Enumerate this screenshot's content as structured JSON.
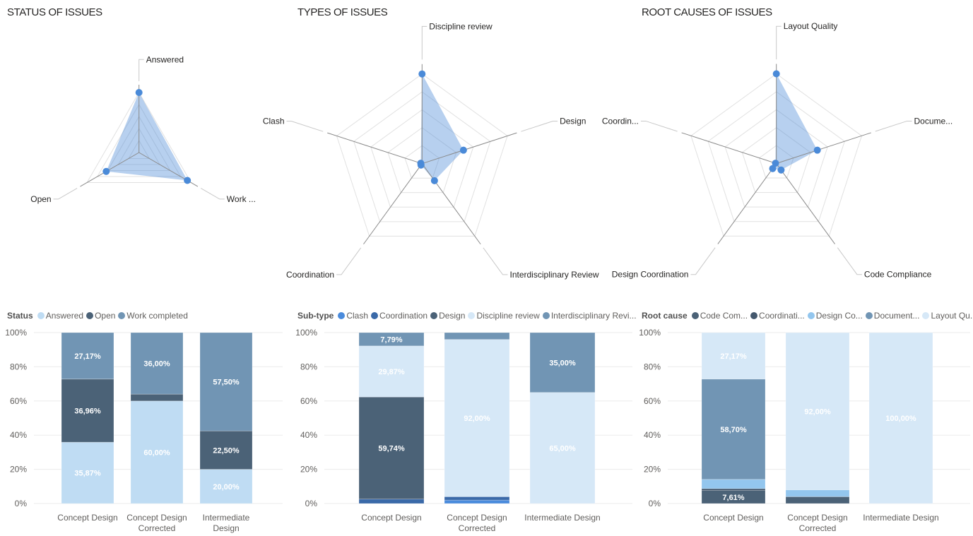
{
  "titles": {
    "status": "STATUS OF ISSUES",
    "types": "TYPES OF ISSUES",
    "root_causes": "ROOT CAUSES OF ISSUES"
  },
  "chart_data": [
    {
      "id": "status-radar",
      "type": "radar",
      "title": "STATUS OF ISSUES",
      "axes": [
        "Answered",
        "Work ...",
        "Open"
      ],
      "values": [
        1.0,
        0.93,
        0.63
      ],
      "value_scale": "fraction of outer ring (max = 1)",
      "rings": 5,
      "series_color": "#4a8ad8",
      "grid_color": "#e1e1e1"
    },
    {
      "id": "types-radar",
      "type": "radar",
      "title": "TYPES OF ISSUES",
      "axes": [
        "Discipline review",
        "Design",
        "Interdisciplinary Review",
        "Coordination",
        "Clash"
      ],
      "values": [
        1.0,
        0.485,
        0.235,
        0.02,
        0.015
      ],
      "value_scale": "fraction of outer ring (max = 1)",
      "rings": 5,
      "series_color": "#4a8ad8",
      "grid_color": "#e1e1e1"
    },
    {
      "id": "root-causes-radar",
      "type": "radar",
      "title": "ROOT CAUSES OF ISSUES",
      "axes": [
        "Layout Quality",
        "Docume...",
        "Code Compliance",
        "Design Coordination",
        "Coordin..."
      ],
      "values": [
        1.0,
        0.48,
        0.09,
        0.07,
        0.01
      ],
      "value_scale": "fraction of outer ring (max = 1)",
      "rings": 5,
      "series_color": "#4a8ad8",
      "grid_color": "#e1e1e1"
    },
    {
      "id": "status-bar",
      "type": "bar",
      "stacking": "100%",
      "legend_title": "Status",
      "legend": "top-left",
      "categories": [
        [
          "Concept Design"
        ],
        [
          "Concept Design",
          "Corrected"
        ],
        [
          "Intermediate",
          "Design"
        ]
      ],
      "series": [
        {
          "name": "Answered",
          "color": "#bfdcf3",
          "values": [
            35.87,
            60.0,
            20.0
          ],
          "labels": [
            "35,87%",
            "60,00%",
            "20,00%"
          ]
        },
        {
          "name": "Open",
          "color": "#4b6277",
          "values": [
            36.96,
            4.0,
            22.5
          ],
          "labels": [
            "36,96%",
            null,
            "22,50%"
          ]
        },
        {
          "name": "Work completed",
          "color": "#7195b4",
          "values": [
            27.17,
            36.0,
            57.5
          ],
          "labels": [
            "27,17%",
            "36,00%",
            "57,50%"
          ]
        }
      ],
      "ytick_values": [
        0,
        20,
        40,
        60,
        80,
        100
      ],
      "yticks": [
        "0%",
        "20%",
        "40%",
        "60%",
        "80%",
        "100%"
      ],
      "ylim": [
        0,
        100
      ],
      "grid": true,
      "xlabel": "",
      "ylabel": ""
    },
    {
      "id": "subtype-bar",
      "type": "bar",
      "stacking": "100%",
      "legend_title": "Sub-type",
      "legend": "top-left",
      "categories": [
        [
          "Concept Design"
        ],
        [
          "Concept Design",
          "Corrected"
        ],
        [
          "Intermediate Design"
        ]
      ],
      "series": [
        {
          "name": "Clash",
          "color": "#4a8bdc",
          "values": [
            0,
            2.0,
            0
          ],
          "labels": [
            null,
            null,
            null
          ]
        },
        {
          "name": "Coordination",
          "color": "#3a69a8",
          "values": [
            2.6,
            2.0,
            0
          ],
          "labels": [
            null,
            null,
            null
          ]
        },
        {
          "name": "Design",
          "color": "#4b6277",
          "values": [
            59.74,
            0,
            0
          ],
          "labels": [
            "59,74%",
            null,
            null
          ]
        },
        {
          "name": "Discipline review",
          "color": "#d6e8f7",
          "values": [
            29.87,
            92.0,
            65.0
          ],
          "labels": [
            "29,87%",
            "92,00%",
            "65,00%"
          ]
        },
        {
          "name": "Interdisciplinary Revi...",
          "color": "#7195b4",
          "values": [
            7.79,
            4.0,
            35.0
          ],
          "labels": [
            "7,79%",
            null,
            "35,00%"
          ]
        }
      ],
      "ytick_values": [
        0,
        20,
        40,
        60,
        80,
        100
      ],
      "yticks": [
        "0%",
        "20%",
        "40%",
        "60%",
        "80%",
        "100%"
      ],
      "ylim": [
        0,
        100
      ],
      "grid": true,
      "xlabel": "",
      "ylabel": ""
    },
    {
      "id": "root-cause-bar",
      "type": "bar",
      "stacking": "100%",
      "legend_title": "Root cause",
      "legend": "top-left",
      "categories": [
        [
          "Concept Design"
        ],
        [
          "Concept Design",
          "Corrected"
        ],
        [
          "Intermediate Design"
        ]
      ],
      "series": [
        {
          "name": "Code Com...",
          "color": "#4b6277",
          "values": [
            7.61,
            4.0,
            0
          ],
          "labels": [
            "7,61%",
            null,
            null
          ]
        },
        {
          "name": "Coordinati...",
          "color": "#44586d",
          "values": [
            1.09,
            0,
            0
          ],
          "labels": [
            null,
            null,
            null
          ]
        },
        {
          "name": "Design Co...",
          "color": "#93c6ee",
          "values": [
            5.43,
            4.0,
            0
          ],
          "labels": [
            null,
            null,
            null
          ]
        },
        {
          "name": "Document...",
          "color": "#7195b4",
          "values": [
            58.7,
            0,
            0
          ],
          "labels": [
            "58,70%",
            null,
            null
          ]
        },
        {
          "name": "Layout Qu...",
          "color": "#d6e8f7",
          "values": [
            27.17,
            92.0,
            100.0
          ],
          "labels": [
            "27,17%",
            "92,00%",
            "100,00%"
          ]
        }
      ],
      "ytick_values": [
        0,
        20,
        40,
        60,
        80,
        100
      ],
      "yticks": [
        "0%",
        "20%",
        "40%",
        "60%",
        "80%",
        "100%"
      ],
      "ylim": [
        0,
        100
      ],
      "grid": true,
      "xlabel": "",
      "ylabel": ""
    }
  ]
}
